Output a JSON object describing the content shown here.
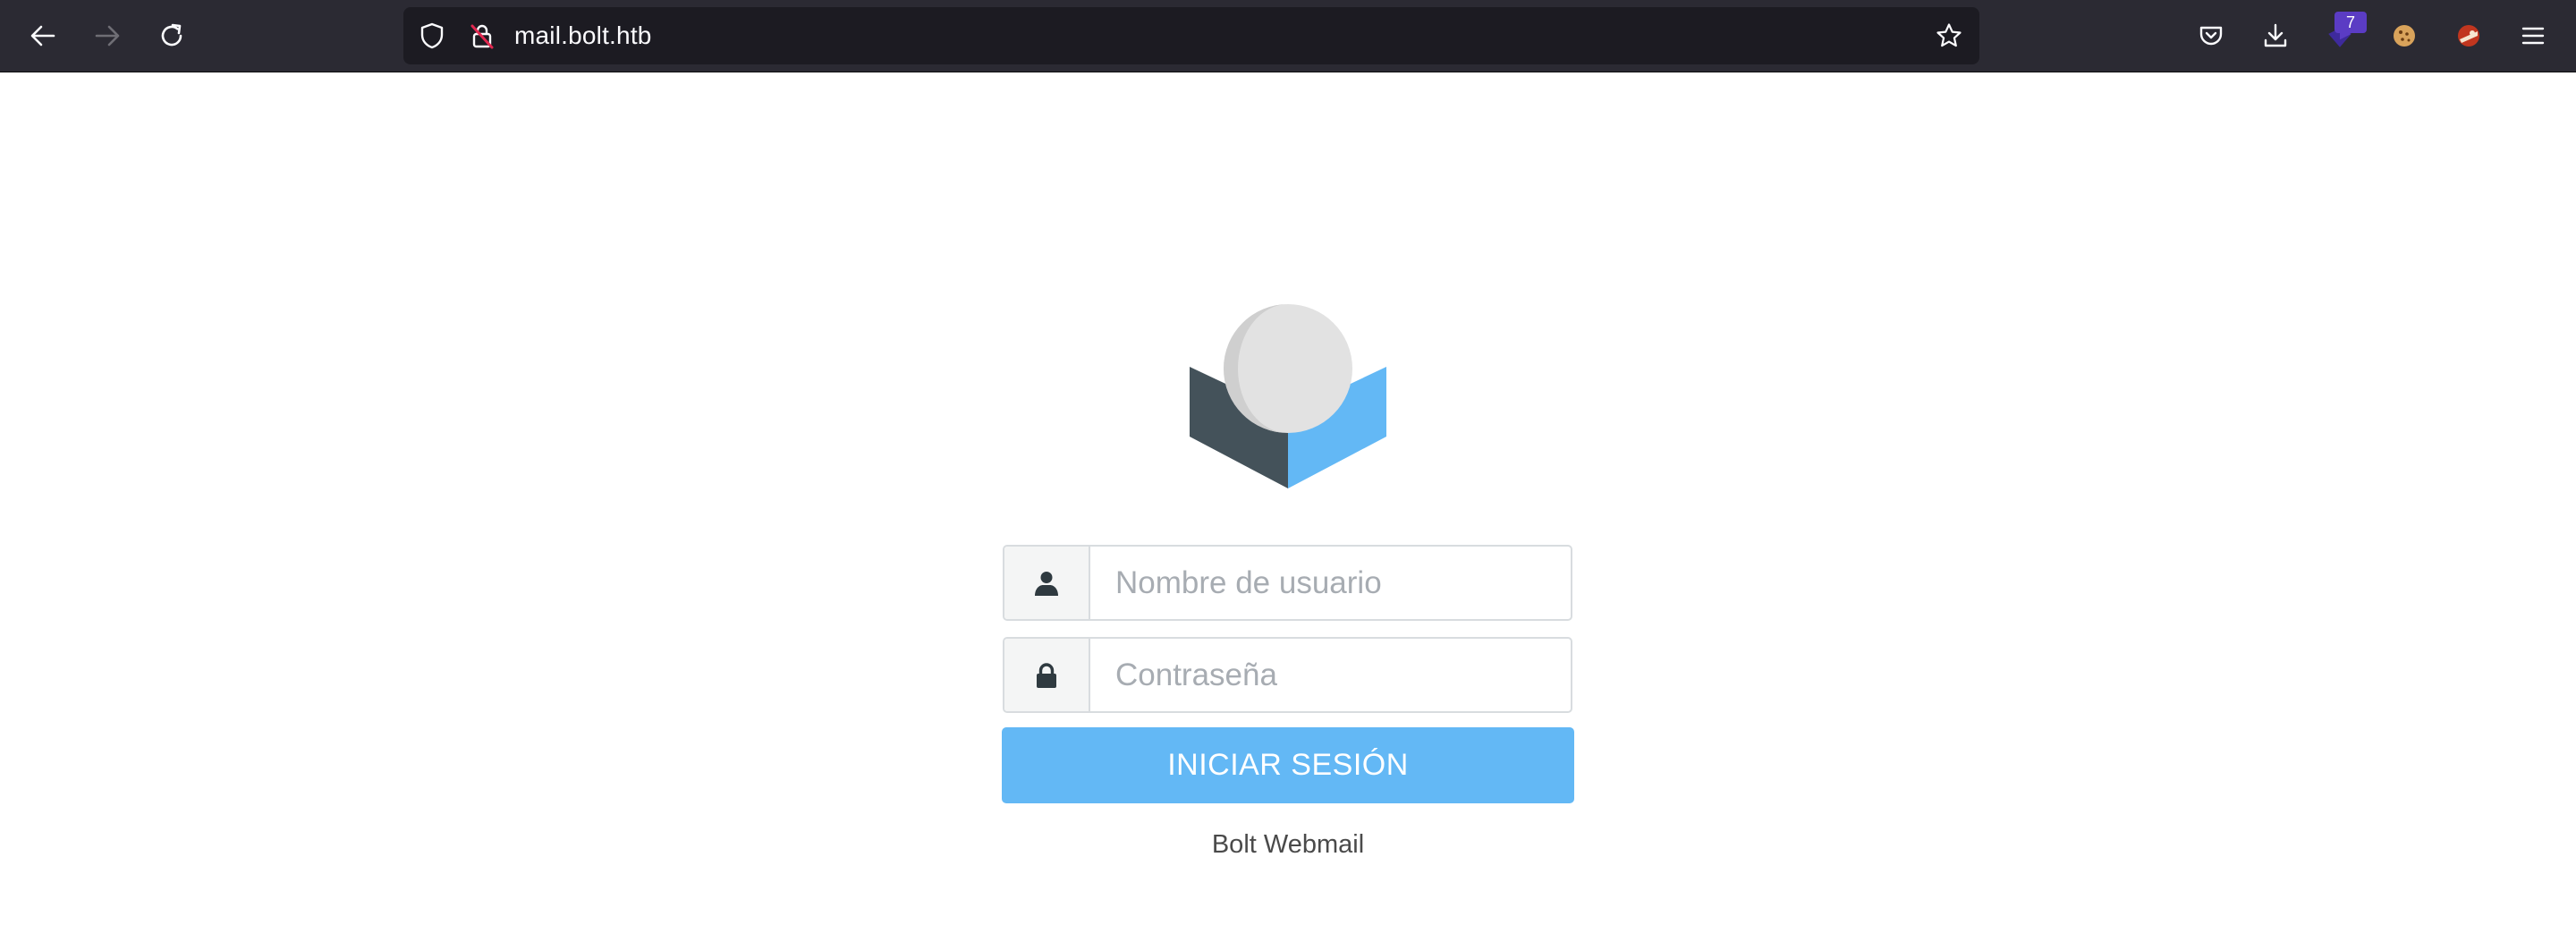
{
  "browser": {
    "url": "mail.bolt.htb",
    "extension_badge_count": "7",
    "icons": {
      "back": "arrow-left-icon",
      "forward": "arrow-right-icon",
      "reload": "reload-icon",
      "tracking_protection": "shield-icon",
      "connection": "insecure-lock-icon",
      "bookmark": "star-icon",
      "pocket": "pocket-icon",
      "downloads": "download-icon",
      "extension": "extension-icon",
      "cookie": "cookie-icon",
      "profile": "profile-icon",
      "menu": "hamburger-menu-icon"
    }
  },
  "login": {
    "username_placeholder": "Nombre de usuario",
    "password_placeholder": "Contraseña",
    "submit_label": "INICIAR SESIÓN",
    "footer": "Bolt Webmail"
  },
  "colors": {
    "toolbar_bg": "#2b2a33",
    "urlbar_bg": "#1c1b22",
    "accent": "#63b8f5",
    "logo_dark": "#44525a",
    "logo_blue": "#63b8f5",
    "logo_ball": "#e2e2e2"
  }
}
